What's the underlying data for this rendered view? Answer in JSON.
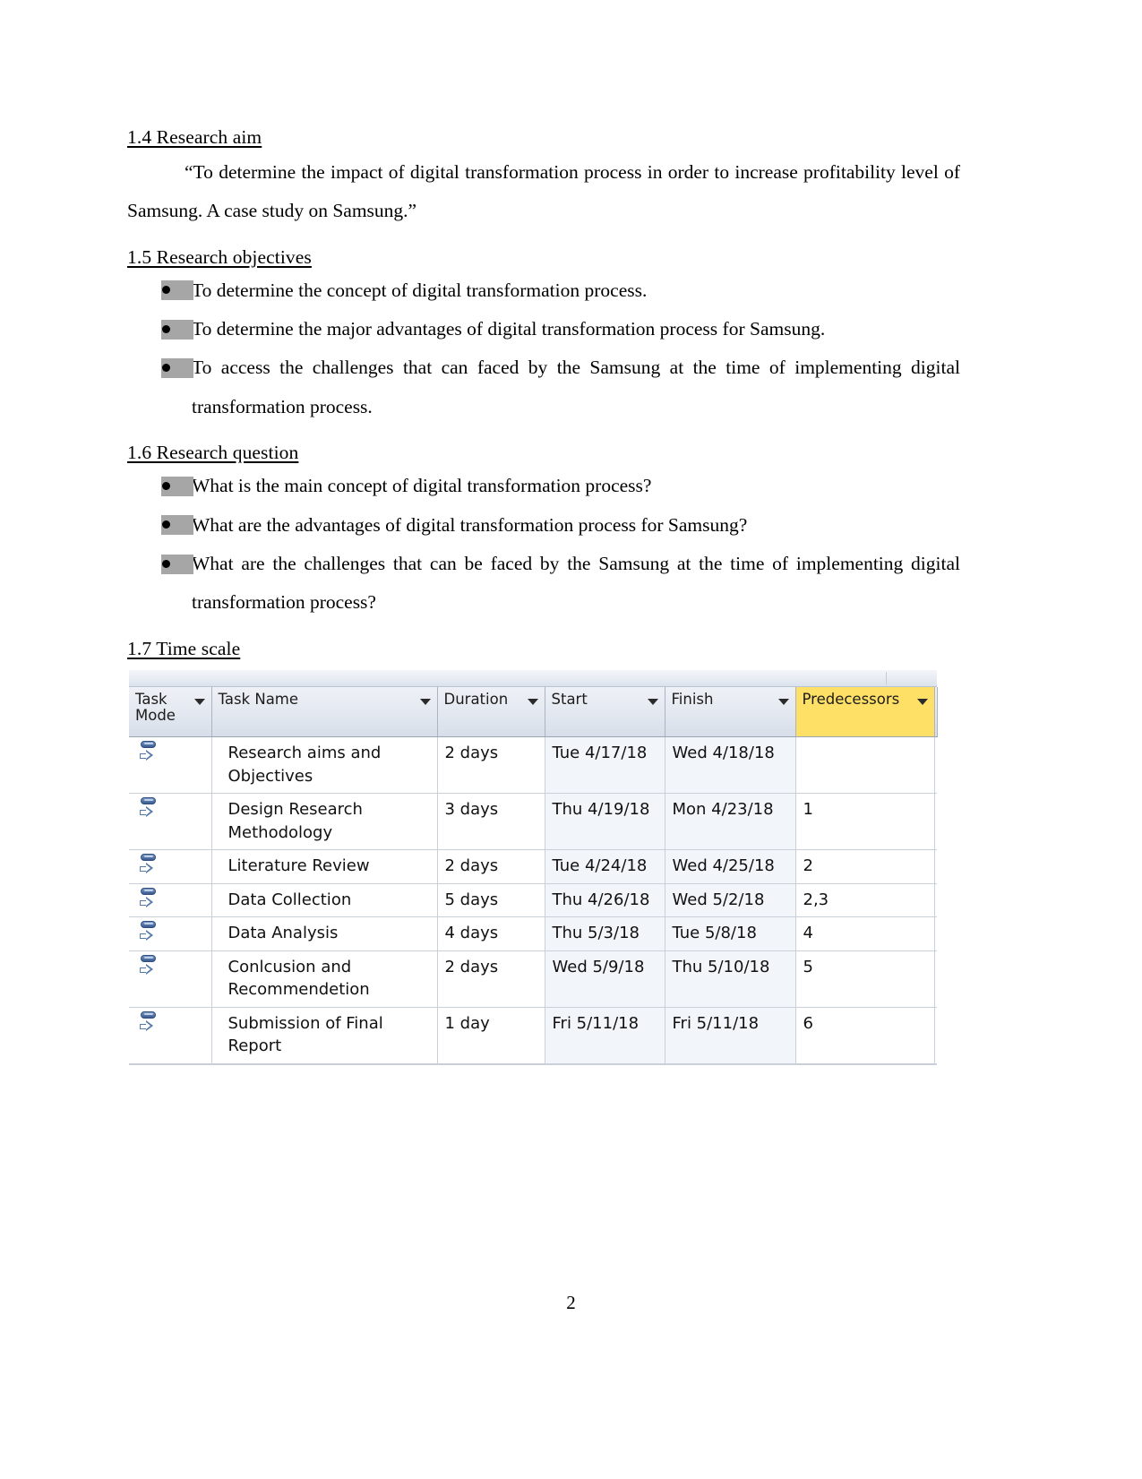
{
  "document": {
    "page_number": "2"
  },
  "sections": [
    {
      "heading": "1.4 Research aim",
      "paragraph": "“To determine the impact of digital transformation process in order to increase profitability level of Samsung. A case study on  Samsung.”"
    },
    {
      "heading": "1.5 Research objectives",
      "bullets": [
        "To determine the concept of digital transformation process.",
        "To determine the major advantages of digital transformation process for Samsung.",
        "To access the challenges that can faced by the  Samsung at the time of implementing digital transformation process."
      ]
    },
    {
      "heading": "1.6 Research question",
      "bullets": [
        "What is the main concept of digital transformation process?",
        "What are the advantages of digital transformation process for Samsung?",
        "What are the challenges that can be faced by the Samsung at the time of implementing digital transformation process?"
      ]
    },
    {
      "heading": "1.7 Time scale"
    }
  ],
  "timescale_table": {
    "columns": [
      {
        "label": "Task Mode",
        "has_filter": true,
        "highlight": false
      },
      {
        "label": "Task Name",
        "has_filter": true,
        "highlight": false
      },
      {
        "label": "Duration",
        "has_filter": true,
        "highlight": false
      },
      {
        "label": "Start",
        "has_filter": true,
        "highlight": false
      },
      {
        "label": "Finish",
        "has_filter": true,
        "highlight": false
      },
      {
        "label": "Predecessors",
        "has_filter": true,
        "highlight": true
      }
    ],
    "highlight_color": "#ffe066",
    "rows": [
      {
        "mode_icon": "manually-scheduled-icon",
        "task_name": "Research aims and Objectives",
        "duration": "2 days",
        "start": "Tue 4/17/18",
        "finish": "Wed 4/18/18",
        "predecessors": ""
      },
      {
        "mode_icon": "manually-scheduled-icon",
        "task_name": "Design Research Methodology",
        "duration": "3 days",
        "start": "Thu 4/19/18",
        "finish": "Mon 4/23/18",
        "predecessors": "1"
      },
      {
        "mode_icon": "manually-scheduled-icon",
        "task_name": "Literature Review",
        "duration": "2 days",
        "start": "Tue 4/24/18",
        "finish": "Wed 4/25/18",
        "predecessors": "2"
      },
      {
        "mode_icon": "manually-scheduled-icon",
        "task_name": "Data Collection",
        "duration": "5 days",
        "start": "Thu 4/26/18",
        "finish": "Wed 5/2/18",
        "predecessors": "2,3"
      },
      {
        "mode_icon": "manually-scheduled-icon",
        "task_name": "Data Analysis",
        "duration": "4 days",
        "start": "Thu 5/3/18",
        "finish": "Tue 5/8/18",
        "predecessors": "4"
      },
      {
        "mode_icon": "manually-scheduled-icon",
        "task_name": "Conlcusion and Recommendetion",
        "duration": "2 days",
        "start": "Wed 5/9/18",
        "finish": "Thu 5/10/18",
        "predecessors": "5"
      },
      {
        "mode_icon": "manually-scheduled-icon",
        "task_name": "Submission of Final Report",
        "duration": "1 day",
        "start": "Fri 5/11/18",
        "finish": "Fri 5/11/18",
        "predecessors": "6"
      }
    ]
  }
}
